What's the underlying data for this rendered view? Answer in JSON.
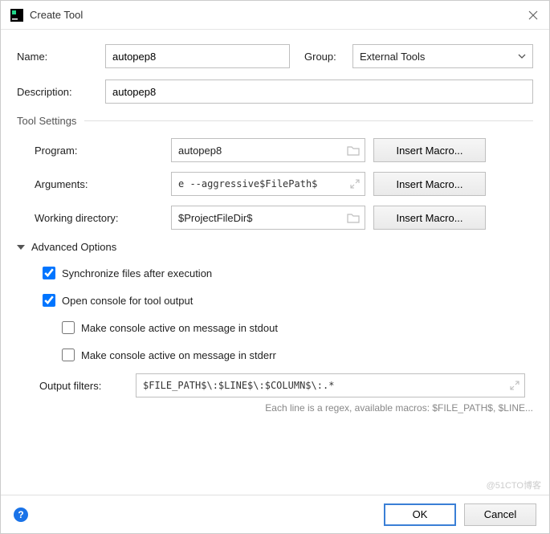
{
  "window": {
    "title": "Create Tool"
  },
  "labels": {
    "name": "Name:",
    "group": "Group:",
    "description": "Description:",
    "tool_settings": "Tool Settings",
    "program": "Program:",
    "arguments": "Arguments:",
    "working_dir": "Working directory:",
    "advanced": "Advanced Options",
    "output_filters": "Output filters:"
  },
  "fields": {
    "name": "autopep8",
    "group_selected": "External Tools",
    "description": "autopep8",
    "program": "autopep8",
    "arguments": "e --aggressive$FilePath$",
    "working_dir": "$ProjectFileDir$",
    "output_filters": "$FILE_PATH$\\:$LINE$\\:$COLUMN$\\:.*"
  },
  "checkboxes": {
    "sync_files": {
      "label": "Synchronize files after execution",
      "checked": true
    },
    "open_console": {
      "label": "Open console for tool output",
      "checked": true
    },
    "active_stdout": {
      "label": "Make console active on message in stdout",
      "checked": false
    },
    "active_stderr": {
      "label": "Make console active on message in stderr",
      "checked": false
    }
  },
  "buttons": {
    "insert_macro": "Insert Macro...",
    "ok": "OK",
    "cancel": "Cancel"
  },
  "hint": "Each line is a regex, available macros: $FILE_PATH$, $LINE...",
  "watermark": "@51CTO博客"
}
